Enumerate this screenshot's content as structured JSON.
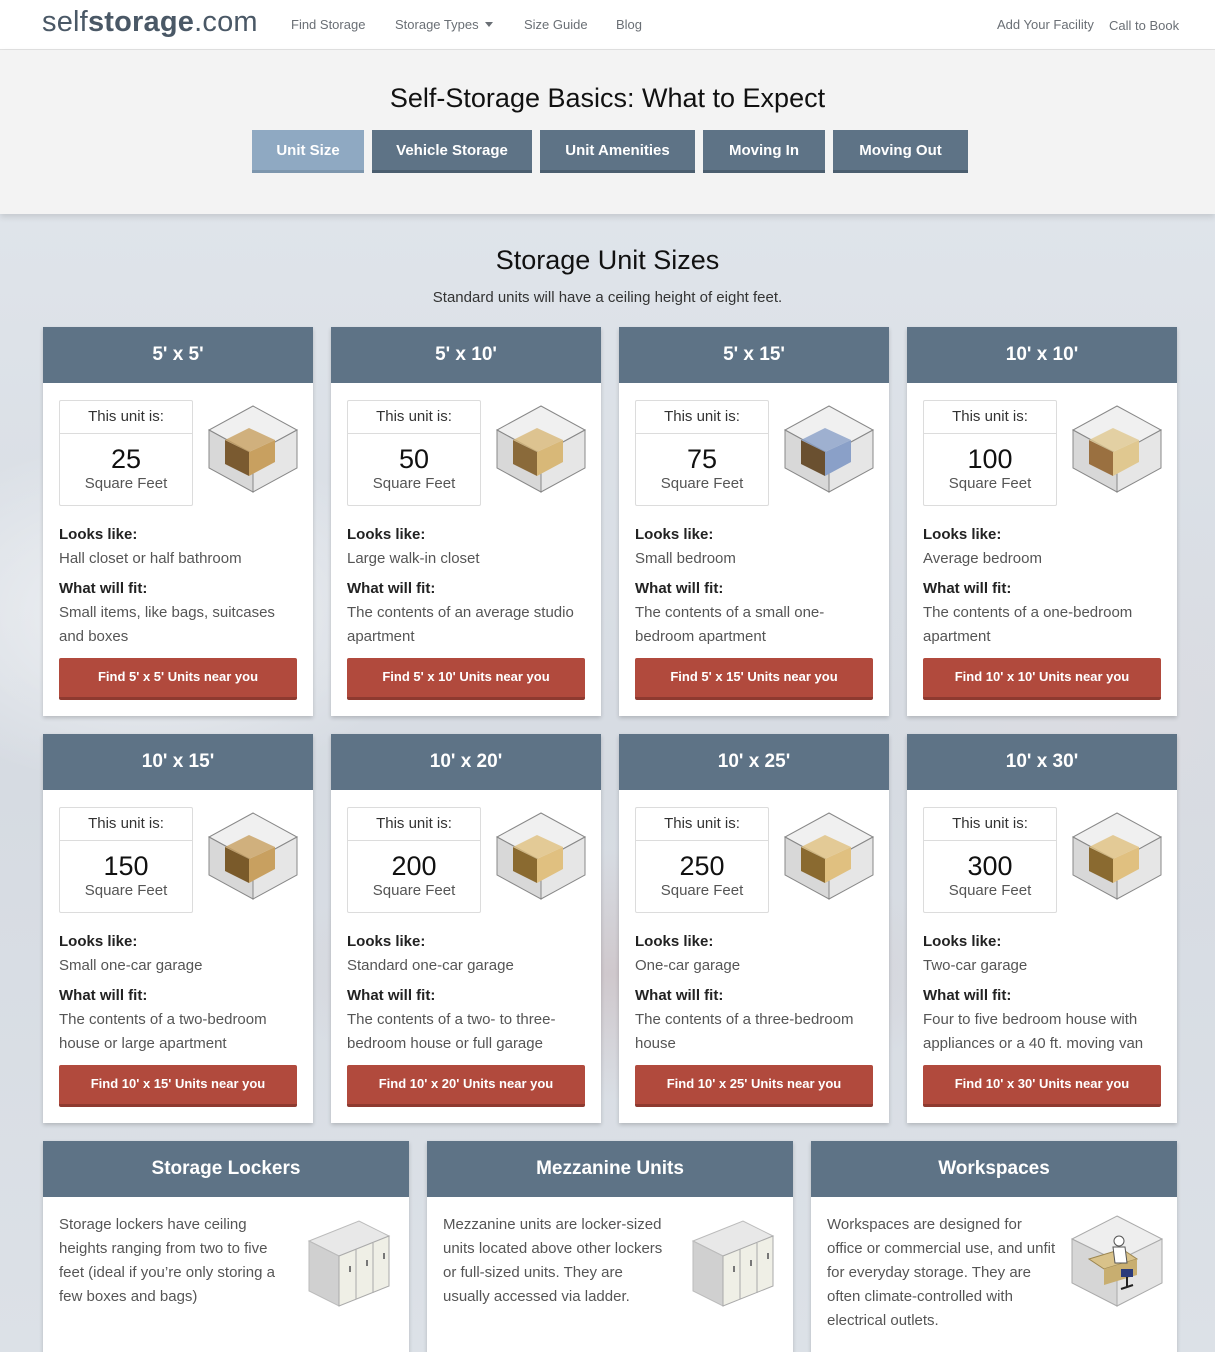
{
  "nav": {
    "logo_light": "self",
    "logo_bold": "storage",
    "logo_tld": ".com",
    "find_storage": "Find Storage",
    "storage_types": "Storage Types",
    "size_guide": "Size Guide",
    "blog": "Blog",
    "add_facility": "Add Your Facility",
    "call_to_book": "Call to Book"
  },
  "hero": {
    "title": "Self-Storage Basics: What to Expect",
    "tabs": [
      "Unit Size",
      "Vehicle Storage",
      "Unit Amenities",
      "Moving In",
      "Moving Out"
    ],
    "active_tab": "Unit Size"
  },
  "section": {
    "title": "Storage Unit Sizes",
    "subtitle": "Standard units will have a ceiling height of eight feet."
  },
  "unit_label": "This unit is:",
  "sqft_label": "Square Feet",
  "looks_like_label": "Looks like:",
  "what_fits_label": "What will fit:",
  "units": [
    {
      "size": "5' x 5'",
      "sqft": "25",
      "looks": "Hall closet or half bathroom",
      "fits": "Small items, like bags, suitcases and boxes",
      "button": "Find 5' x 5' Units near you"
    },
    {
      "size": "5' x 10'",
      "sqft": "50",
      "looks": "Large walk-in closet",
      "fits": "The contents of an average studio apartment",
      "button": "Find 5' x 10' Units near you"
    },
    {
      "size": "5' x 15'",
      "sqft": "75",
      "looks": "Small bedroom",
      "fits": "The contents of a small one-bedroom apartment",
      "button": "Find 5' x 15' Units near you"
    },
    {
      "size": "10' x 10'",
      "sqft": "100",
      "looks": "Average bedroom",
      "fits": "The contents of a one-bedroom apartment",
      "button": "Find 10' x 10' Units near you"
    },
    {
      "size": "10' x 15'",
      "sqft": "150",
      "looks": "Small one-car garage",
      "fits": "The contents of a two-bedroom house or large apartment",
      "button": "Find 10' x 15' Units near you"
    },
    {
      "size": "10' x 20'",
      "sqft": "200",
      "looks": "Standard one-car garage",
      "fits": "The contents of a two- to three-bedroom house or full garage",
      "button": "Find 10' x 20' Units near you"
    },
    {
      "size": "10' x 25'",
      "sqft": "250",
      "looks": "One-car garage",
      "fits": "The contents of a three-bedroom house",
      "button": "Find 10' x 25' Units near you"
    },
    {
      "size": "10' x 30'",
      "sqft": "300",
      "looks": "Two-car garage",
      "fits": "Four to five bedroom house with appliances or a 40 ft. moving van",
      "button": "Find 10' x 30' Units near you"
    }
  ],
  "extras": [
    {
      "title": "Storage Lockers",
      "text": "Storage lockers have ceiling heights ranging from two to five feet (ideal if you’re only storing a few boxes and bags)"
    },
    {
      "title": "Mezzanine Units",
      "text": "Mezzanine units are locker-sized units located above other lockers or full-sized units. They are usually accessed via ladder."
    },
    {
      "title": "Workspaces",
      "text": "Workspaces are designed for office or commercial use, and unfit for everyday storage. They are often climate-controlled with electrical outlets."
    }
  ],
  "colors": {
    "header_slate": "#5e7386",
    "button_red": "#b14a3d",
    "tab_active": "#8fa9c2"
  }
}
